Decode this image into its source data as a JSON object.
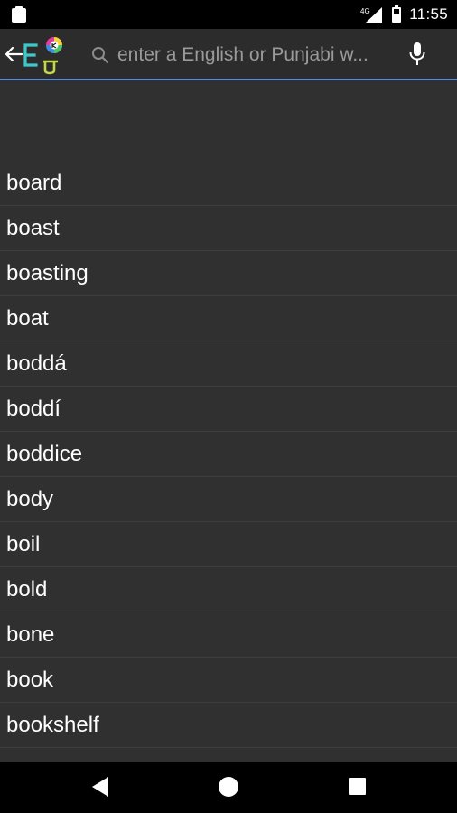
{
  "status_bar": {
    "time": "11:55",
    "network_label": "4G"
  },
  "toolbar": {
    "search_placeholder": "enter a English or Punjabi w..."
  },
  "word_list": {
    "items": [
      "board",
      "boast",
      "boasting",
      "boat",
      "boddá",
      "boddí",
      "boddice",
      "body",
      "boil",
      "bold",
      "bone",
      "book",
      "bookshelf"
    ]
  },
  "colors": {
    "background": "#303030",
    "accent_underline": "#5b8bd0",
    "divider": "#3e3e3e"
  }
}
